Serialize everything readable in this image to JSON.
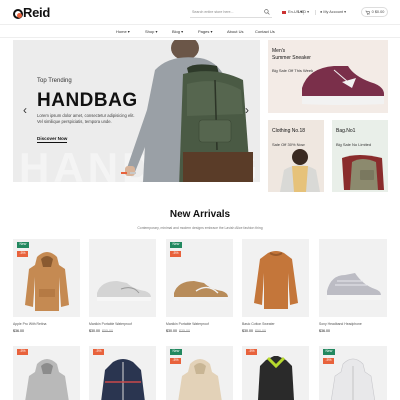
{
  "header": {
    "logo_text": "Reid",
    "search_placeholder": "Search entire store here...",
    "language": "En-US",
    "currency": "USD",
    "account": "My Account",
    "cart": "0 $0.00"
  },
  "nav": {
    "items": [
      {
        "label": "Home"
      },
      {
        "label": "Shop"
      },
      {
        "label": "Blog"
      },
      {
        "label": "Pages"
      },
      {
        "label": "About Us"
      },
      {
        "label": "Contact Us"
      }
    ]
  },
  "hero": {
    "subtitle": "Top Trending",
    "title": "HANDBAG",
    "background_word": "HANDBAG",
    "description": "Lorem ipsum dolor amet, consectetur adipisicing elit. Vel similique perspiciatis, tempora unde.",
    "button": "Discover Now",
    "prev_icon": "‹",
    "next_icon": "›",
    "slides": 2,
    "active_slide": 1
  },
  "banners": {
    "sneaker": {
      "title_line1": "Men's",
      "title_line2": "Summer Sneaker",
      "subtitle": "Big Sale Off This Week"
    },
    "clothing": {
      "title": "Clothing No.18",
      "subtitle": "Sale Off 30% Now"
    },
    "bag": {
      "title": "Bag.No1",
      "subtitle": "Big Sale No Limited"
    }
  },
  "new_arrivals": {
    "title": "New Arrivals",
    "subtitle": "Contemporary, minimal and modern designs embrace the Lavish Alice fashion thing",
    "products": [
      {
        "badges": [
          "New",
          "-5%"
        ],
        "name": "Apple Pro With Retina",
        "price": "$36.00",
        "old_price": "",
        "image": "tan-hoodie",
        "color": "#c58a52"
      },
      {
        "badges": [],
        "name": "Manikin Portable Waterproof",
        "price": "$30.00",
        "old_price": "$55.00",
        "image": "grey-sneaker",
        "color": "#d4d4d4"
      },
      {
        "badges": [
          "New",
          "-5%"
        ],
        "name": "Manikin Portable Waterproof",
        "price": "$30.00",
        "old_price": "$35.00",
        "image": "tan-sneaker",
        "color": "#b88c5a"
      },
      {
        "badges": [],
        "name": "Basic Cotton Sweater",
        "price": "$30.00",
        "old_price": "$50.00",
        "image": "orange-sweater",
        "color": "#c4763a"
      },
      {
        "badges": [],
        "name": "Sony Headband Headphone",
        "price": "$36.00",
        "old_price": "",
        "image": "white-sneaker",
        "color": "#bcbcc4"
      }
    ],
    "row2": [
      {
        "badges": [
          "-5%"
        ],
        "image": "grey-hoodie",
        "color": "#b9b9b9"
      },
      {
        "badges": [
          "-5%"
        ],
        "image": "navy-jacket",
        "color": "#2a3550"
      },
      {
        "badges": [
          "New",
          "-5%"
        ],
        "image": "beige-hoodie",
        "color": "#e3d2b8"
      },
      {
        "badges": [
          "-5%"
        ],
        "image": "black-vest",
        "color": "#2a2a2a"
      },
      {
        "badges": [
          "New",
          "-5%"
        ],
        "image": "white-jacket",
        "color": "#e8e8ea"
      }
    ]
  },
  "colors": {
    "accent": "#e8623c",
    "new_badge": "#22885f",
    "hero_bg": "#ececec",
    "sneaker_banner_bg": "#f3ebe6",
    "clothing_banner_bg": "#efe7e0",
    "bag_banner_bg": "#e9efe9"
  }
}
